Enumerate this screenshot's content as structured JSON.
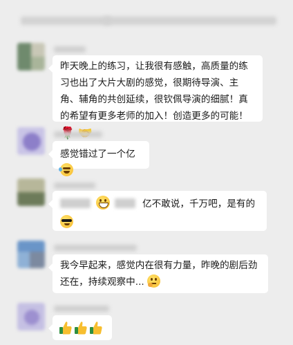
{
  "messages": [
    {
      "text": "昨天晚上的练习，让我很有感触，高质量的练习也出了大片大剧的感觉，很期待导演、主角、辅角的共创延续，很钦佩导演的细腻！真的希望有更多老师的加入！创造更多的可能！"
    },
    {
      "text": "感觉错过了一个亿"
    },
    {
      "text_after": "亿不敢说，千万吧，是有的"
    },
    {
      "text": "我今早起来，感觉内在很有力量，昨晚的剧后劲还在，持续观察中..."
    }
  ],
  "icons": {
    "rose": "rose-icon",
    "handshake": "handshake-icon",
    "laugh_cry": "laughing-crying-face-icon",
    "grin": "grinning-face-icon",
    "sunglasses": "sunglasses-face-icon",
    "thinking": "thinking-face-icon",
    "thumbs": "thumbs-up-icon"
  }
}
